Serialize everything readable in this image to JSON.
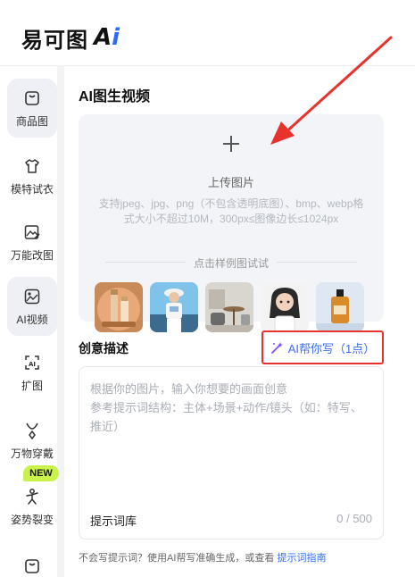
{
  "header": {
    "logo_text": "易可图",
    "logo_ai_a": "A",
    "logo_ai_i": "i"
  },
  "sidebar": {
    "items": [
      {
        "label": "商品图",
        "icon": "shopping-bag-icon",
        "active": true
      },
      {
        "label": "模特试衣",
        "icon": "tshirt-icon",
        "active": false
      },
      {
        "label": "万能改图",
        "icon": "image-edit-icon",
        "active": false
      },
      {
        "label": "AI视频",
        "icon": "video-image-icon",
        "active": true
      },
      {
        "label": "扩图",
        "icon": "expand-ai-icon",
        "active": false
      },
      {
        "label": "万物穿戴",
        "icon": "necklace-icon",
        "active": false
      },
      {
        "label": "姿势裂变",
        "icon": "pose-icon",
        "active": false
      },
      {
        "label": "",
        "icon": "bag-icon",
        "active": false
      }
    ],
    "new_badge": "NEW"
  },
  "main": {
    "title": "AI图生视频",
    "upload": {
      "title": "上传图片",
      "desc": "支持jpeg、jpg、png（不包含透明底图）、bmp、webp格式大小不超过10M，300px≤图像边长≤1024px",
      "sample_hint": "点击样例图试试"
    },
    "samples": [
      "cosmetics-sample",
      "model-sample",
      "furniture-sample",
      "child-sample",
      "perfume-sample"
    ],
    "description": {
      "title": "创意描述",
      "ai_write_label": "AI帮你写（1点）",
      "placeholder": "根据你的图片，输入你想要的画面创意\n参考提示词结构：主体+场景+动作/镜头（如：特写、推近）",
      "prompt_library": "提示词库",
      "counter": "0 / 500"
    },
    "footer": {
      "tip": "不会写提示词？使用AI帮写准确生成，或查看 ",
      "link": "提示词指南"
    }
  },
  "colors": {
    "accent": "#2f6bff",
    "highlight_border": "#e8322d",
    "new_badge": "#c9f24a"
  }
}
